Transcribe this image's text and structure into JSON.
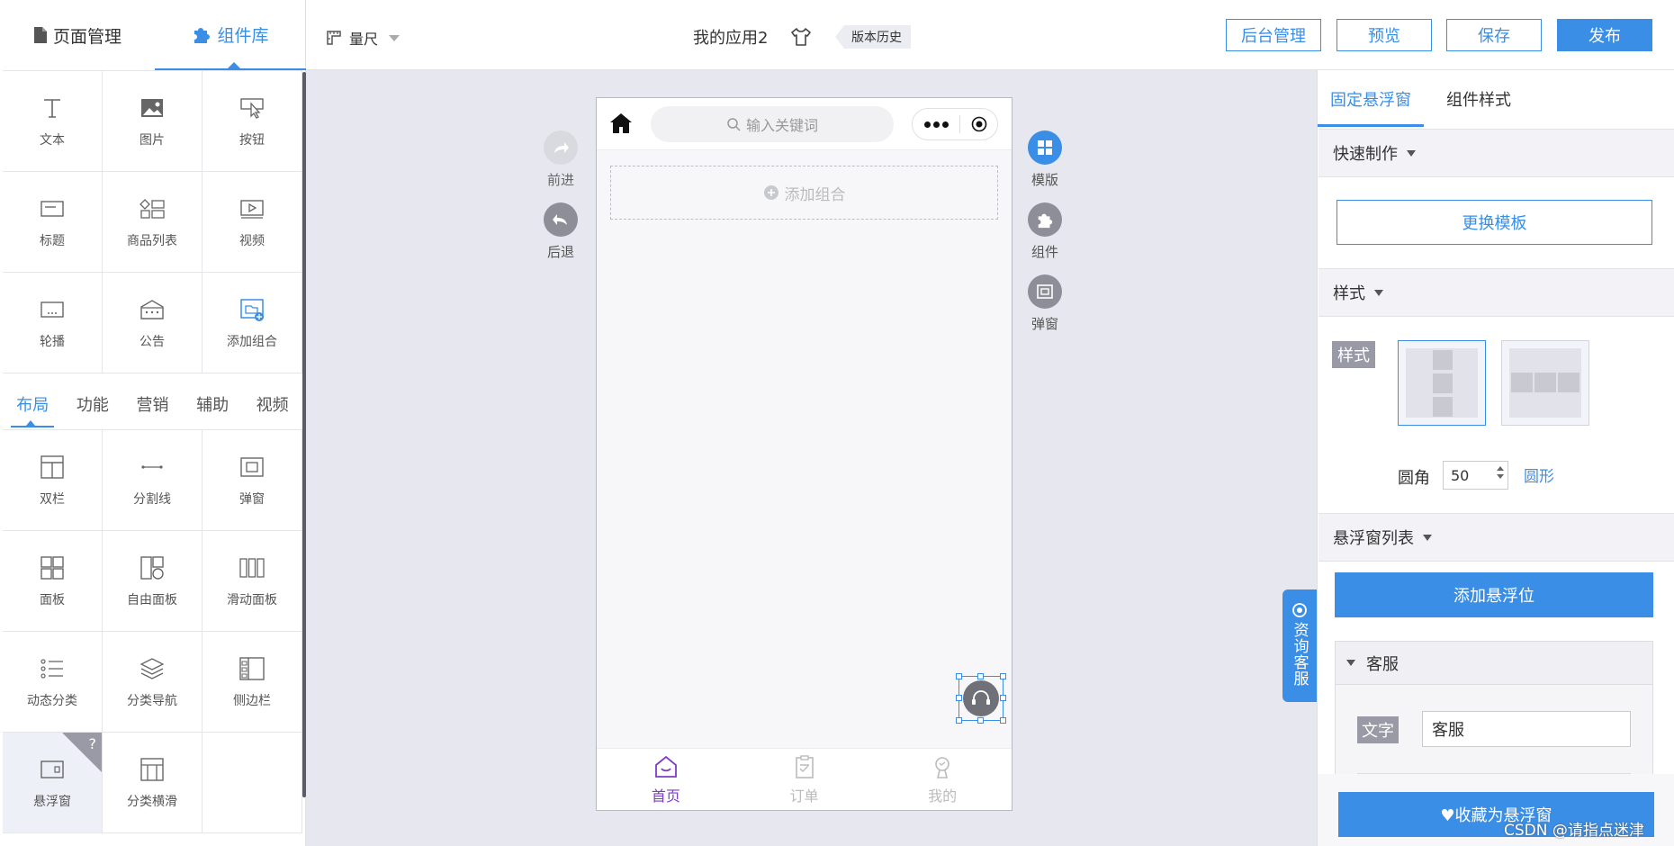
{
  "topbar": {
    "ruler_label": "量尺",
    "app_name": "我的应用2",
    "version_history": "版本历史",
    "admin_btn": "后台管理",
    "preview_btn": "预览",
    "save_btn": "保存",
    "publish_btn": "发布"
  },
  "left_panel": {
    "tabs": [
      {
        "label": "页面管理",
        "icon": "page-icon"
      },
      {
        "label": "组件库",
        "icon": "puzzle-icon"
      }
    ],
    "basic_components": [
      "文本",
      "图片",
      "按钮",
      "标题",
      "商品列表",
      "视频",
      "轮播",
      "公告",
      "添加组合"
    ],
    "categories": [
      "布局",
      "功能",
      "营销",
      "辅助",
      "视频"
    ],
    "layout_components": [
      "双栏",
      "分割线",
      "弹窗",
      "面板",
      "自由面板",
      "滑动面板",
      "动态分类",
      "分类导航",
      "侧边栏",
      "悬浮窗",
      "分类横滑"
    ],
    "help_badge": "?"
  },
  "canvas": {
    "forward_label": "前进",
    "back_label": "后退",
    "search_placeholder": "输入关键词",
    "add_group_label": "添加组合",
    "template_label": "模版",
    "component_label": "组件",
    "popup_label": "弹窗",
    "tabbar": [
      {
        "label": "首页",
        "icon": "home-smile-icon",
        "active": true
      },
      {
        "label": "订单",
        "icon": "clipboard-icon",
        "active": false
      },
      {
        "label": "我的",
        "icon": "user-icon",
        "active": false
      }
    ],
    "consult_tab": "资询客服"
  },
  "right_panel": {
    "tabs": [
      "固定悬浮窗",
      "组件样式"
    ],
    "quick_make": "快速制作",
    "change_template": "更换模板",
    "style_section": "样式",
    "style_chip": "样式",
    "radius_label": "圆角",
    "radius_value": "50",
    "circle_link": "圆形",
    "float_list": "悬浮窗列表",
    "add_float_btn": "添加悬浮位",
    "item_title": "客服",
    "text_chip": "文字",
    "text_value": "客服",
    "fav_btn": "♥收藏为悬浮窗"
  },
  "watermark": "CSDN @请指点迷津",
  "colors": {
    "accent": "#3a8ee6",
    "purple": "#7d3cc8"
  }
}
